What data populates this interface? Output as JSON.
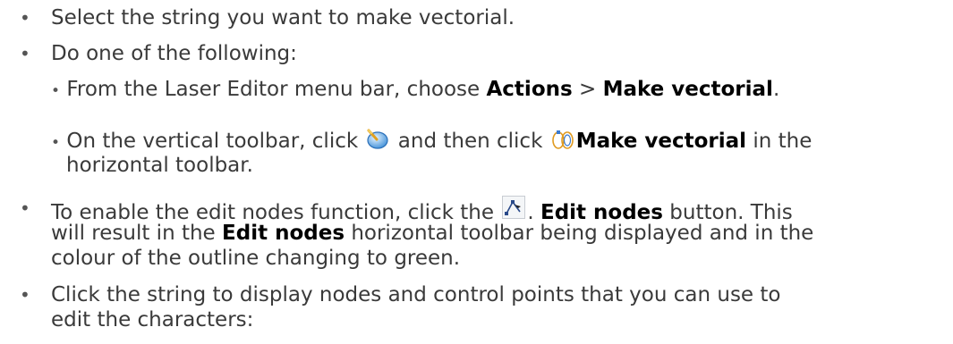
{
  "bullet_char": "•",
  "items": {
    "i1": {
      "text": "Select the string you want to make vectorial."
    },
    "i2": {
      "text": "Do one of the following:",
      "sub1": {
        "pre": "From the Laser Editor menu bar, choose ",
        "actions": "Actions",
        "sep": " > ",
        "make": "Make vectorial",
        "post": "."
      },
      "sub2": {
        "pre": "On the vertical toolbar, click ",
        "mid": " and then click ",
        "make": "Make vectorial",
        "post": " in the",
        "line2": "horizontal toolbar.",
        "icon1": "vectorize-tool-icon",
        "icon2": "make-vectorial-icon"
      }
    },
    "i3": {
      "pre": "To enable the edit nodes function, click the ",
      "dot": ". ",
      "bold1": "Edit nodes",
      "post1": " button. This",
      "line2_pre": "will result in the ",
      "bold2": "Edit nodes",
      "line2_post": " horizontal toolbar being displayed and in the",
      "line3": "colour of the outline changing to green.",
      "icon": "edit-nodes-icon"
    },
    "i4": {
      "line1": "Click the string to display nodes and control points that you can use to",
      "line2": "edit the characters:"
    }
  }
}
